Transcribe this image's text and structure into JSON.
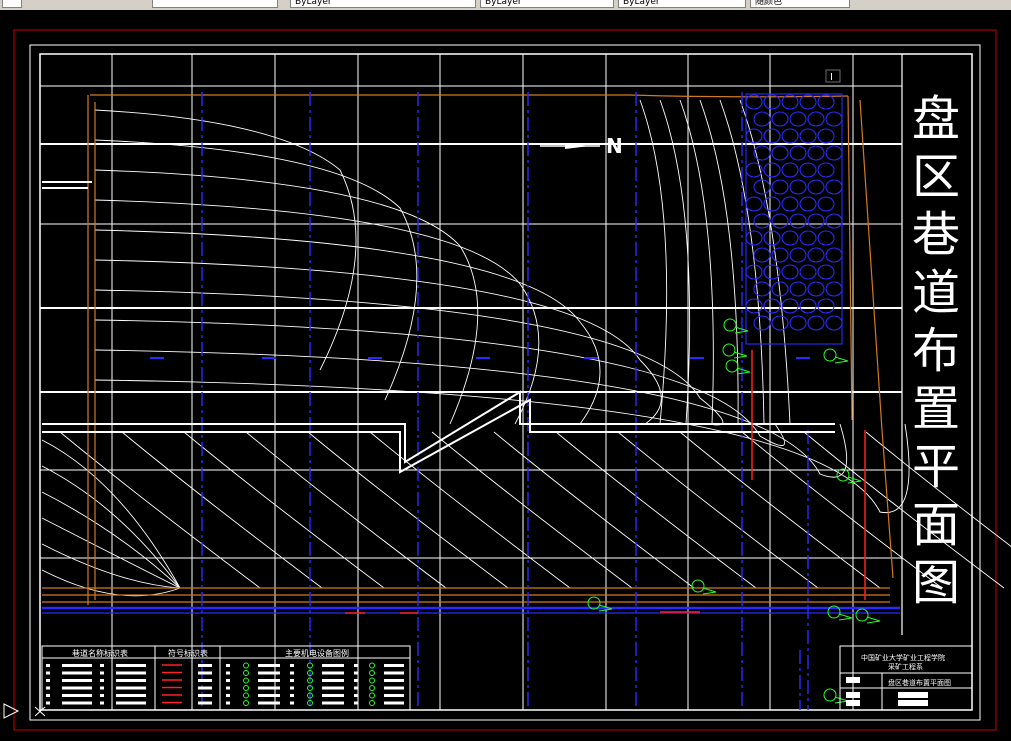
{
  "toolbar": {
    "fields": [
      {
        "id": "layer-combo",
        "value": ""
      },
      {
        "id": "color-combo",
        "value": ""
      },
      {
        "id": "linetype-combo",
        "value": "ByLayer"
      },
      {
        "id": "lineweight-combo",
        "value": "ByLayer"
      },
      {
        "id": "plotstyle-combo",
        "value": "ByLayer"
      },
      {
        "id": "style-combo",
        "value": "随颜色"
      }
    ]
  },
  "drawing": {
    "title_chars": [
      "盘",
      "区",
      "巷",
      "道",
      "布",
      "置",
      "平",
      "面",
      "图"
    ],
    "north_arrow_label": "N",
    "sheet_mark": "I",
    "legend_tables": [
      {
        "title": "巷道名称标识表"
      },
      {
        "title": "符号标识表"
      },
      {
        "title": "主要机电设备图例"
      }
    ],
    "title_block": {
      "org": "中国矿业大学矿业工程学院",
      "dept": "采矿工程系",
      "drawing_name": "盘区巷道布置平面图"
    }
  },
  "colors": {
    "background": "#000000",
    "frame_red": "#cc0000",
    "grid_white": "#ffffff",
    "blue_roadway": "#2a2aff",
    "orange_boundary": "#d27a1e",
    "green_equipment": "#22ff22",
    "red_marks": "#ff2020"
  }
}
